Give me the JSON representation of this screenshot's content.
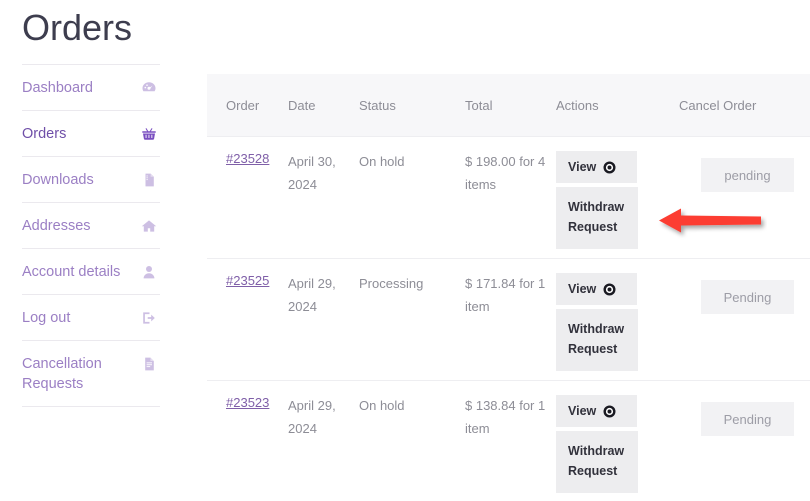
{
  "page": {
    "title": "Orders"
  },
  "sidebar": {
    "items": [
      {
        "label": "Dashboard",
        "icon": "dashboard-gauge-icon",
        "active": false
      },
      {
        "label": "Orders",
        "icon": "shopping-basket-icon",
        "active": true
      },
      {
        "label": "Downloads",
        "icon": "download-file-icon",
        "active": false
      },
      {
        "label": "Addresses",
        "icon": "home-icon",
        "active": false
      },
      {
        "label": "Account details",
        "icon": "user-icon",
        "active": false
      },
      {
        "label": "Log out",
        "icon": "logout-icon",
        "active": false
      },
      {
        "label": "Cancellation Requests",
        "icon": "document-icon",
        "active": false
      }
    ]
  },
  "table": {
    "columns": [
      "Order",
      "Date",
      "Status",
      "Total",
      "Actions",
      "Cancel Order"
    ],
    "rows": [
      {
        "order": "#23528",
        "date": "April 30, 2024",
        "status": "On hold",
        "total": "$ 198.00 for 4 items",
        "view_label": "View",
        "withdraw_label": "Withdraw Request",
        "cancel_state": "pending"
      },
      {
        "order": "#23525",
        "date": "April 29, 2024",
        "status": "Processing",
        "total": "$ 171.84 for 1 item",
        "view_label": "View",
        "withdraw_label": "Withdraw Request",
        "cancel_state": "Pending"
      },
      {
        "order": "#23523",
        "date": "April 29, 2024",
        "status": "On hold",
        "total": "$ 138.84 for 1 item",
        "view_label": "View",
        "withdraw_label": "Withdraw Request",
        "cancel_state": "Pending"
      }
    ]
  },
  "annotation": {
    "type": "arrow-left",
    "color": "#fc3d32",
    "points_at": "withdraw-request-button-row-1"
  },
  "colors": {
    "link": "#7f5fa8",
    "nav_label": "#9b7fc4",
    "nav_label_active": "#6f4fa8",
    "header_bg": "#f7f7f9",
    "button_bg": "#ededef",
    "muted_text": "#8d8d96",
    "arrow": "#fc3d32"
  }
}
